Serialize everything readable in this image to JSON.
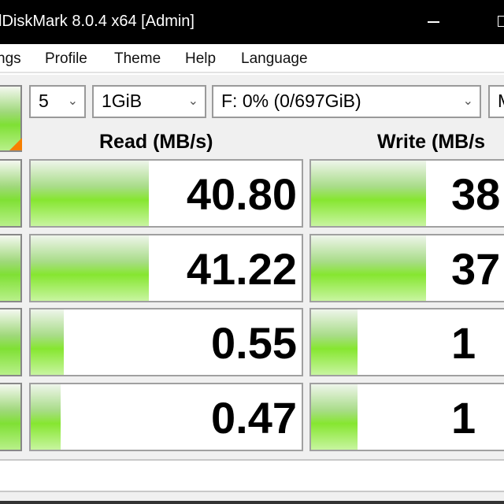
{
  "window": {
    "title": "lDiskMark 8.0.4 x64 [Admin]"
  },
  "menu": [
    "ngs",
    "Profile",
    "Theme",
    "Help",
    "Language"
  ],
  "controls": {
    "count": "5",
    "size": "1GiB",
    "drive": "F: 0% (0/697GiB)",
    "unit": "M"
  },
  "headers": {
    "read": "Read (MB/s)",
    "write": "Write (MB/s"
  },
  "results": [
    {
      "read": "40.80",
      "write": "38",
      "read_fill": 0.43,
      "write_fill": 0.42
    },
    {
      "read": "41.22",
      "write": "37",
      "read_fill": 0.43,
      "write_fill": 0.42
    },
    {
      "read": "0.55",
      "write": "1",
      "read_fill": 0.12,
      "write_fill": 0.17
    },
    {
      "read": "0.47",
      "write": "1",
      "read_fill": 0.11,
      "write_fill": 0.17
    }
  ],
  "colors": {
    "bar": "#86e630",
    "accent": "#f77f00"
  }
}
